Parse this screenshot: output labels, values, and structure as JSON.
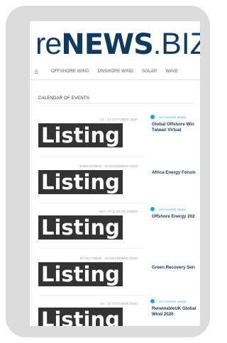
{
  "site": {
    "logo_re": "re",
    "logo_news": "NEWS",
    "logo_dot": ".",
    "logo_biz": "BIZ"
  },
  "nav": {
    "home_icon": "home-icon",
    "items": [
      "OFFSHORE WIND",
      "ONSHORE WIND",
      "SOLAR",
      "WAVE"
    ]
  },
  "calendar": {
    "title": "CALENDAR OF EVENTS",
    "listing_label": "Listing",
    "events": [
      {
        "date": "13 - 14 OCTOBER 2020",
        "tag": "OFFSHORE WIND",
        "name": "Global Offshore Win\nTaiwan Virtual"
      },
      {
        "date": "SUBSCRIBED - 23 NOVEMBER 2020",
        "tag": "",
        "name": "Africa Energy Forum"
      },
      {
        "date": "OCT. 27 & 28 OCTOBER",
        "tag": "OFFSHORE WIND",
        "name": "Offshore Energy 202"
      },
      {
        "date": "29 OCTOBER - 26 NOVEMBER 2020",
        "tag": "",
        "name": "Green Recovery Seri"
      },
      {
        "date": "20 - 22 OCTOBER 2020",
        "tag": "OFFSHORE WIND",
        "name": "RenewableUK Global\nWind 2020"
      }
    ]
  }
}
